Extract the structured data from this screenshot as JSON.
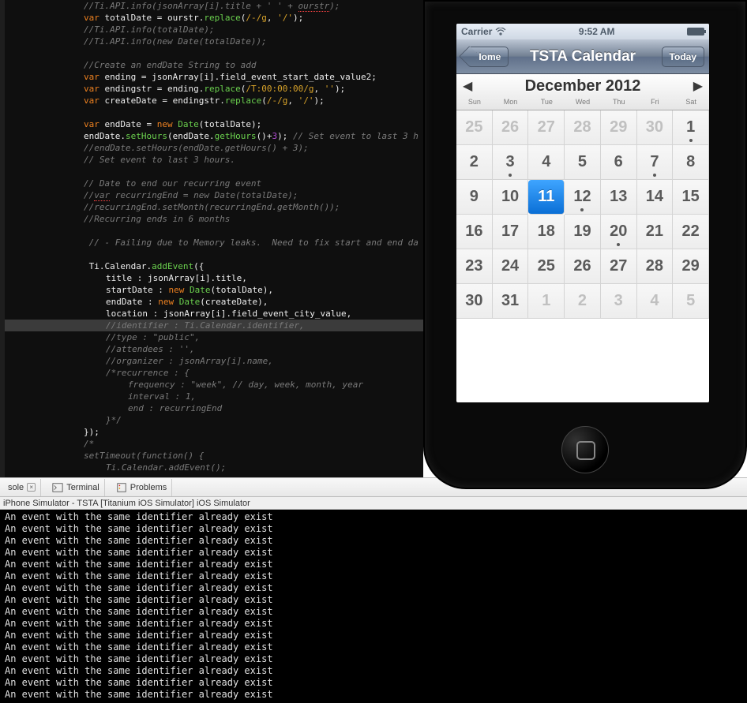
{
  "editor": {
    "highlighted_line_index": 28,
    "code_lines": [
      {
        "i": 0,
        "indent": 4,
        "comment": "//Ti.API.info(jsonArray[i].title + ' ' + ourstr);",
        "squiggle": "ourstr"
      },
      {
        "i": 1,
        "indent": 4,
        "plain": true,
        "segs": [
          [
            "kw",
            "var"
          ],
          [
            "sp",
            " "
          ],
          [
            "ident",
            "totalDate"
          ],
          [
            "sp",
            " "
          ],
          [
            "op",
            "="
          ],
          [
            "sp",
            " "
          ],
          [
            "ident",
            "ourstr"
          ],
          [
            "op",
            "."
          ],
          [
            "fn",
            "replace"
          ],
          [
            "op",
            "("
          ],
          [
            "regex",
            "/-/g"
          ],
          [
            "op",
            ", "
          ],
          [
            "str",
            "'/'"
          ],
          [
            "op",
            ");"
          ]
        ]
      },
      {
        "i": 2,
        "indent": 4,
        "comment": "//Ti.API.info(totalDate);"
      },
      {
        "i": 3,
        "indent": 4,
        "comment": "//Ti.API.info(new Date(totalDate));"
      },
      {
        "i": 4,
        "indent": 4,
        "blank": true
      },
      {
        "i": 5,
        "indent": 4,
        "comment": "//Create an endDate String to add"
      },
      {
        "i": 6,
        "indent": 4,
        "segs": [
          [
            "kw",
            "var"
          ],
          [
            "sp",
            " "
          ],
          [
            "ident",
            "ending"
          ],
          [
            "sp",
            " "
          ],
          [
            "op",
            "="
          ],
          [
            "sp",
            " "
          ],
          [
            "ident",
            "jsonArray"
          ],
          [
            "op",
            "["
          ],
          [
            "ident",
            "i"
          ],
          [
            "op",
            "]."
          ],
          [
            "ident",
            "field_event_start_date_value2"
          ],
          [
            "op",
            ";"
          ]
        ]
      },
      {
        "i": 7,
        "indent": 4,
        "segs": [
          [
            "kw",
            "var"
          ],
          [
            "sp",
            " "
          ],
          [
            "ident",
            "endingstr"
          ],
          [
            "sp",
            " "
          ],
          [
            "op",
            "="
          ],
          [
            "sp",
            " "
          ],
          [
            "ident",
            "ending"
          ],
          [
            "op",
            "."
          ],
          [
            "fn",
            "replace"
          ],
          [
            "op",
            "("
          ],
          [
            "regex",
            "/T:00:00:00/g"
          ],
          [
            "op",
            ", "
          ],
          [
            "str",
            "''"
          ],
          [
            "op",
            ");"
          ]
        ]
      },
      {
        "i": 8,
        "indent": 4,
        "segs": [
          [
            "kw",
            "var"
          ],
          [
            "sp",
            " "
          ],
          [
            "ident",
            "createDate"
          ],
          [
            "sp",
            " "
          ],
          [
            "op",
            "="
          ],
          [
            "sp",
            " "
          ],
          [
            "ident",
            "endingstr"
          ],
          [
            "op",
            "."
          ],
          [
            "fn",
            "replace"
          ],
          [
            "op",
            "("
          ],
          [
            "regex",
            "/-/g"
          ],
          [
            "op",
            ", "
          ],
          [
            "str",
            "'/'"
          ],
          [
            "op",
            ");"
          ]
        ]
      },
      {
        "i": 9,
        "indent": 4,
        "blank": true
      },
      {
        "i": 10,
        "indent": 4,
        "segs": [
          [
            "kw",
            "var"
          ],
          [
            "sp",
            " "
          ],
          [
            "ident",
            "endDate"
          ],
          [
            "sp",
            " "
          ],
          [
            "op",
            "="
          ],
          [
            "sp",
            " "
          ],
          [
            "kw",
            "new"
          ],
          [
            "sp",
            " "
          ],
          [
            "fn",
            "Date"
          ],
          [
            "op",
            "("
          ],
          [
            "ident",
            "totalDate"
          ],
          [
            "op",
            ");"
          ]
        ]
      },
      {
        "i": 11,
        "indent": 4,
        "segs": [
          [
            "ident",
            "endDate"
          ],
          [
            "op",
            "."
          ],
          [
            "fn",
            "setHours"
          ],
          [
            "op",
            "("
          ],
          [
            "ident",
            "endDate"
          ],
          [
            "op",
            "."
          ],
          [
            "fn",
            "getHours"
          ],
          [
            "op",
            "()"
          ],
          [
            "op",
            "+"
          ],
          [
            "num",
            "3"
          ],
          [
            "op",
            ");"
          ],
          [
            "sp",
            " "
          ],
          [
            "comment",
            "// Set event to last 3 h"
          ]
        ]
      },
      {
        "i": 12,
        "indent": 4,
        "comment": "//endDate.setHours(endDate.getHours() + 3);"
      },
      {
        "i": 13,
        "indent": 4,
        "comment": "// Set event to last 3 hours."
      },
      {
        "i": 14,
        "indent": 4,
        "blank": true
      },
      {
        "i": 15,
        "indent": 4,
        "comment": "// Date to end our recurring event"
      },
      {
        "i": 16,
        "indent": 4,
        "comment": "//var recurringEnd = new Date(totalDate);",
        "squiggle": "var"
      },
      {
        "i": 17,
        "indent": 4,
        "comment": "//recurringEnd.setMonth(recurringEnd.getMonth());"
      },
      {
        "i": 18,
        "indent": 4,
        "comment": "//Recurring ends in 6 months"
      },
      {
        "i": 19,
        "indent": 4,
        "blank": true
      },
      {
        "i": 20,
        "indent": 4,
        "comment": " // - Failing due to Memory leaks.  Need to fix start and end da"
      },
      {
        "i": 21,
        "indent": 4,
        "blank": true
      },
      {
        "i": 22,
        "indent": 4,
        "segs": [
          [
            "sp",
            " "
          ],
          [
            "ident",
            "Ti"
          ],
          [
            "op",
            "."
          ],
          [
            "ident",
            "Calendar"
          ],
          [
            "op",
            "."
          ],
          [
            "fn",
            "addEvent"
          ],
          [
            "op",
            "({"
          ]
        ]
      },
      {
        "i": 23,
        "indent": 8,
        "segs": [
          [
            "ident",
            "title"
          ],
          [
            "sp",
            " "
          ],
          [
            "op",
            ":"
          ],
          [
            "sp",
            " "
          ],
          [
            "ident",
            "jsonArray"
          ],
          [
            "op",
            "["
          ],
          [
            "ident",
            "i"
          ],
          [
            "op",
            "]."
          ],
          [
            "ident",
            "title"
          ],
          [
            "op",
            ","
          ]
        ]
      },
      {
        "i": 24,
        "indent": 8,
        "segs": [
          [
            "ident",
            "startDate"
          ],
          [
            "sp",
            " "
          ],
          [
            "op",
            ":"
          ],
          [
            "sp",
            " "
          ],
          [
            "kw",
            "new"
          ],
          [
            "sp",
            " "
          ],
          [
            "fn",
            "Date"
          ],
          [
            "op",
            "("
          ],
          [
            "ident",
            "totalDate"
          ],
          [
            "op",
            "),"
          ]
        ]
      },
      {
        "i": 25,
        "indent": 8,
        "segs": [
          [
            "ident",
            "endDate"
          ],
          [
            "sp",
            " "
          ],
          [
            "op",
            ":"
          ],
          [
            "sp",
            " "
          ],
          [
            "kw",
            "new"
          ],
          [
            "sp",
            " "
          ],
          [
            "fn",
            "Date"
          ],
          [
            "op",
            "("
          ],
          [
            "ident",
            "createDate"
          ],
          [
            "op",
            "),"
          ]
        ]
      },
      {
        "i": 26,
        "indent": 8,
        "segs": [
          [
            "ident",
            "location"
          ],
          [
            "sp",
            " "
          ],
          [
            "op",
            ":"
          ],
          [
            "sp",
            " "
          ],
          [
            "ident",
            "jsonArray"
          ],
          [
            "op",
            "["
          ],
          [
            "ident",
            "i"
          ],
          [
            "op",
            "]."
          ],
          [
            "ident",
            "field_event_city_value"
          ],
          [
            "op",
            ","
          ]
        ]
      },
      {
        "i": 27,
        "indent": 8,
        "comment": "//identifier : Ti.Calendar.identifier,"
      },
      {
        "i": 28,
        "indent": 8,
        "comment": "//type : \"public\","
      },
      {
        "i": 29,
        "indent": 8,
        "comment": "//attendees : '',"
      },
      {
        "i": 30,
        "indent": 8,
        "comment": "//organizer : jsonArray[i].name,"
      },
      {
        "i": 31,
        "indent": 8,
        "comment": "/*recurrence : {"
      },
      {
        "i": 32,
        "indent": 12,
        "comment": "frequency : \"week\", // day, week, month, year"
      },
      {
        "i": 33,
        "indent": 12,
        "comment": "interval : 1,"
      },
      {
        "i": 34,
        "indent": 12,
        "comment": "end : recurringEnd"
      },
      {
        "i": 35,
        "indent": 8,
        "comment": "}*/"
      },
      {
        "i": 36,
        "indent": 4,
        "segs": [
          [
            "op",
            "});"
          ]
        ]
      },
      {
        "i": 37,
        "indent": 4,
        "comment": "/*"
      },
      {
        "i": 38,
        "indent": 4,
        "comment": "setTimeout(function() {"
      },
      {
        "i": 39,
        "indent": 8,
        "comment": "Ti.Calendar.addEvent();"
      }
    ]
  },
  "tabs": {
    "console_label": "sole",
    "terminal_label": "Terminal",
    "problems_label": "Problems"
  },
  "subtitle": " iPhone Simulator - TSTA [Titanium iOS Simulator] iOS Simulator",
  "console": {
    "first_line_fragment": "An event with the same identifier already exist",
    "line_text": "An event with the same identifier already exist",
    "repeats": 15,
    "last_partial": "An event with the same identifier already exist"
  },
  "phone": {
    "status": {
      "carrier": "Carrier",
      "time": "9:52 AM"
    },
    "nav": {
      "back": "Home",
      "title": "TSTA Calendar",
      "today": "Today"
    },
    "calendar": {
      "title": "December 2012",
      "day_headers": [
        "Sun",
        "Mon",
        "Tue",
        "Wed",
        "Thu",
        "Fri",
        "Sat"
      ],
      "cells": [
        {
          "n": "25",
          "dim": true
        },
        {
          "n": "26",
          "dim": true
        },
        {
          "n": "27",
          "dim": true
        },
        {
          "n": "28",
          "dim": true
        },
        {
          "n": "29",
          "dim": true
        },
        {
          "n": "30",
          "dim": true
        },
        {
          "n": "1",
          "dot": true
        },
        {
          "n": "2"
        },
        {
          "n": "3",
          "dot": true
        },
        {
          "n": "4"
        },
        {
          "n": "5"
        },
        {
          "n": "6"
        },
        {
          "n": "7",
          "dot": true
        },
        {
          "n": "8"
        },
        {
          "n": "9"
        },
        {
          "n": "10"
        },
        {
          "n": "11",
          "selected": true
        },
        {
          "n": "12",
          "dot": true
        },
        {
          "n": "13"
        },
        {
          "n": "14"
        },
        {
          "n": "15"
        },
        {
          "n": "16"
        },
        {
          "n": "17"
        },
        {
          "n": "18"
        },
        {
          "n": "19"
        },
        {
          "n": "20",
          "dot": true
        },
        {
          "n": "21"
        },
        {
          "n": "22"
        },
        {
          "n": "23"
        },
        {
          "n": "24"
        },
        {
          "n": "25"
        },
        {
          "n": "26"
        },
        {
          "n": "27"
        },
        {
          "n": "28"
        },
        {
          "n": "29"
        },
        {
          "n": "30"
        },
        {
          "n": "31"
        },
        {
          "n": "1",
          "dim": true
        },
        {
          "n": "2",
          "dim": true
        },
        {
          "n": "3",
          "dim": true
        },
        {
          "n": "4",
          "dim": true
        },
        {
          "n": "5",
          "dim": true
        }
      ]
    }
  }
}
